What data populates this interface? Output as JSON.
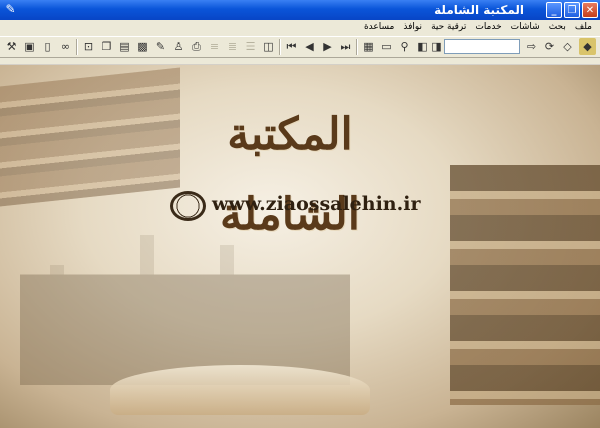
{
  "window": {
    "title": "المكتبة الشاملة",
    "buttons": {
      "minimize": "_",
      "maximize": "❐",
      "close": "✕"
    }
  },
  "menu": [
    "ملف",
    "بحث",
    "شاشات",
    "خدمات",
    "ترقية حية",
    "نوافذ",
    "مساعدة"
  ],
  "toolbar": {
    "search_value": "",
    "icons": [
      "tools-icon",
      "screen-icon",
      "new-page-icon",
      "binoculars-icon",
      "select-icon",
      "copy-icon",
      "paste-icon",
      "image-icon",
      "pencil-icon",
      "person-icon",
      "print-icon",
      "align-right-icon",
      "align-center-icon",
      "list-icon",
      "book-icon",
      "first-icon",
      "prev-icon",
      "next-icon",
      "last-icon",
      "library-icon",
      "open-folder-icon",
      "find-icon",
      "book-open-icon",
      "book-search-icon",
      "search-go-icon",
      "refresh-icon",
      "bookshelf-icon",
      "book-yellow-icon"
    ]
  },
  "banner": {
    "calligraphy": "المكتبة الشاملة",
    "url": "www.ziaossalehin.ir",
    "globe_icon": "globe-search-icon"
  }
}
